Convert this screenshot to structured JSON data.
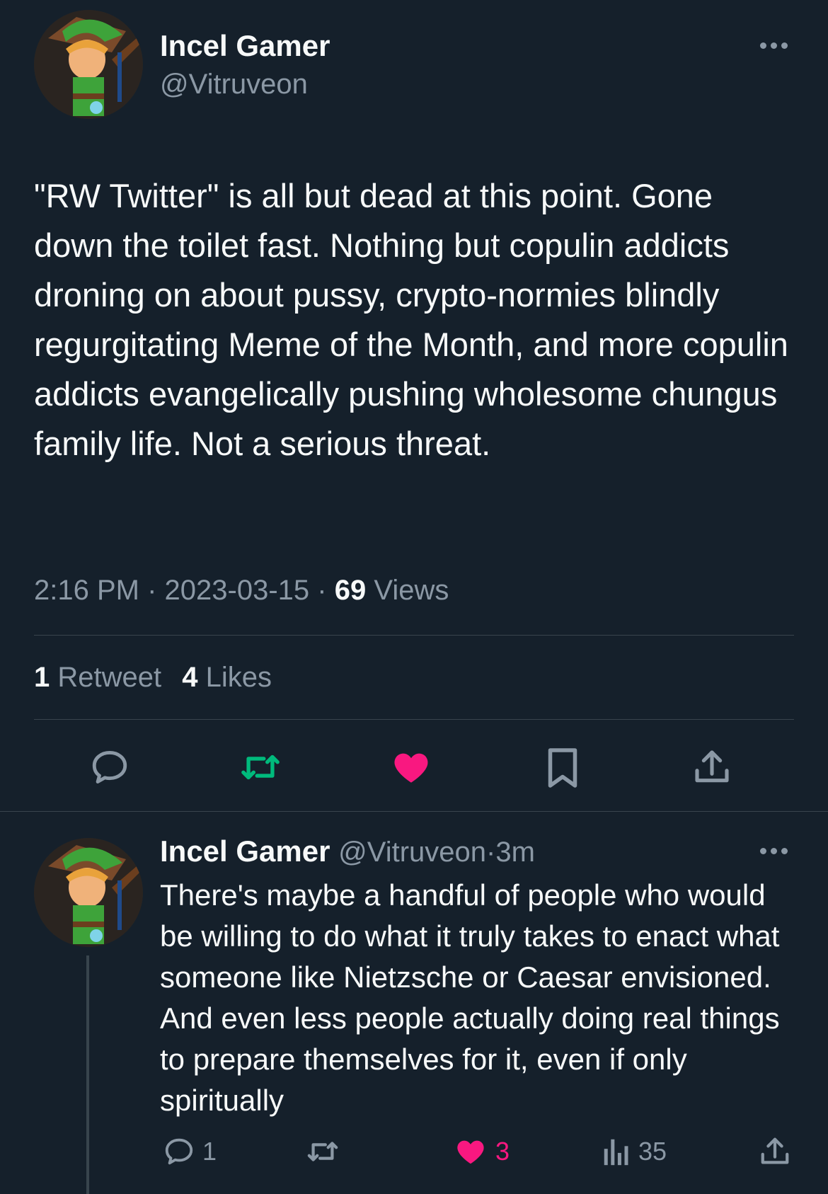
{
  "main_tweet": {
    "display_name": "Incel Gamer",
    "handle": "@Vitruveon",
    "text": "\"RW Twitter\" is all but dead at this point. Gone down the toilet fast. Nothing but copulin addicts droning on about pussy, crypto-normies blindly regurgitating Meme of the Month, and more copulin addicts evangelically pushing wholesome chungus family life. Not a serious threat.",
    "time": "2:16 PM",
    "sep1": "·",
    "date": "2023-03-15",
    "sep2": "·",
    "views_count": "69",
    "views_label": "Views",
    "retweets_count": "1",
    "retweets_label": "Retweet",
    "likes_count": "4",
    "likes_label": "Likes",
    "actions": [
      "reply-icon",
      "retweet-icon",
      "like-icon",
      "bookmark-icon",
      "share-icon"
    ]
  },
  "reply_tweet": {
    "display_name": "Incel Gamer",
    "handle": "@Vitruveon",
    "sep": "·",
    "age": "3m",
    "text": "There's maybe a handful of people who would be willing to do what it truly takes to enact what someone like Nietzsche or Caesar envisioned. And even less people actually doing real things to prepare themselves for it, even if only spiritually",
    "reply_count": "1",
    "retweet_count": "",
    "like_count": "3",
    "view_count": "35"
  },
  "colors": {
    "background": "#15202b",
    "text": "#f7f9f9",
    "muted": "#8b98a5",
    "divider": "#38444d",
    "retweet_green": "#00ba7c",
    "like_pink": "#f91880"
  }
}
